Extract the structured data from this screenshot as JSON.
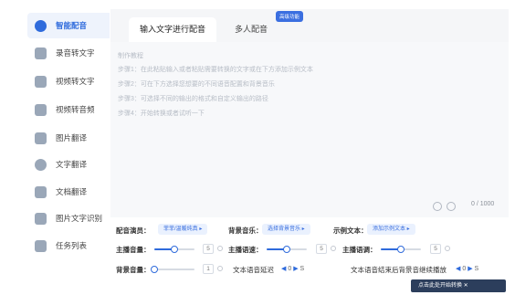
{
  "sidebar": {
    "items": [
      {
        "label": "智能配音",
        "icon": "voice-icon",
        "active": true
      },
      {
        "label": "录音转文字",
        "icon": "record-icon",
        "active": false
      },
      {
        "label": "视频转文字",
        "icon": "video-icon",
        "active": false
      },
      {
        "label": "视频转音频",
        "icon": "video-audio-icon",
        "active": false
      },
      {
        "label": "图片翻译",
        "icon": "image-translate-icon",
        "active": false
      },
      {
        "label": "文字翻译",
        "icon": "text-translate-icon",
        "active": false
      },
      {
        "label": "文档翻译",
        "icon": "doc-translate-icon",
        "active": false
      },
      {
        "label": "图片文字识别",
        "icon": "ocr-icon",
        "active": false
      },
      {
        "label": "任务列表",
        "icon": "task-list-icon",
        "active": false
      }
    ]
  },
  "tabs": {
    "input_text": "输入文字进行配音",
    "multi_voice": "多人配音",
    "pro_badge": "高级功能"
  },
  "editor": {
    "title": "制作教程",
    "steps": [
      "步骤1：在此粘贴输入或者粘贴需要转换的文字或在下方添加示例文本",
      "步骤2：可在下方选择您想要的不同语音配置和背景音乐",
      "步骤3：可选择不同的输出的格式和自定义输出的路径",
      "步骤4：开始转换或者试听一下"
    ],
    "counter": "0 / 1000"
  },
  "controls": {
    "anchor_label": "配音演员：",
    "anchor_value": "菲菲/温暖纯真",
    "bgm_label": "背景音乐：",
    "bgm_value": "选择背景音乐",
    "example_label": "示例文本：",
    "example_value": "添加示例文本",
    "volume_label": "主播音量：",
    "volume_value": "5",
    "volume_level": 0.5,
    "speed_label": "主播语速：",
    "speed_value": "5",
    "speed_level": 0.5,
    "pitch_label": "主播语调：",
    "pitch_value": "5",
    "pitch_level": 0.5,
    "bg_volume_label": "背景音量：",
    "bg_volume_value": "1",
    "bg_volume_level": 0.0,
    "delay_label": "文本语音延迟",
    "delay_value": "0",
    "delay_unit": "S",
    "bgm_after_label": "文本语音结束后背景音继续播放",
    "bgm_after_value": "0",
    "bgm_after_unit": "S"
  },
  "footer": {
    "start_button": "点击此处开始转换  ✕"
  }
}
